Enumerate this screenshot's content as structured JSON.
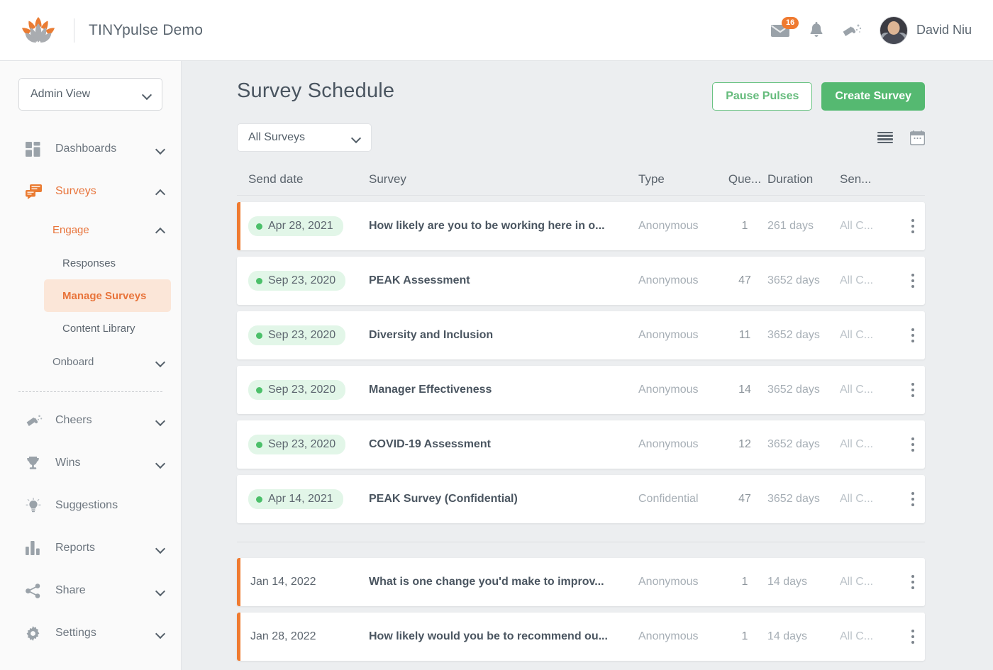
{
  "header": {
    "brand_title": "TINYpulse Demo",
    "logo_icon": "lotus-logo-icon",
    "mail_icon": "envelope-icon",
    "mail_badge": "16",
    "bell_icon": "bell-icon",
    "cheers_icon": "megaphone-icon",
    "avatar_icon": "user-avatar",
    "username": "David Niu"
  },
  "sidebar": {
    "view_selector": {
      "label": "Admin View",
      "chevron": "chevron-down-icon"
    },
    "items": [
      {
        "label": "Dashboards",
        "icon": "grid-dashboard-icon",
        "chevron": "chevron-down-icon",
        "state": "collapsed"
      },
      {
        "label": "Surveys",
        "icon": "survey-chat-icon",
        "chevron": "chevron-up-icon",
        "state": "expanded"
      }
    ],
    "surveys_children": {
      "engage": {
        "label": "Engage",
        "chevron": "chevron-up-icon"
      },
      "engage_children": [
        {
          "label": "Responses"
        },
        {
          "label": "Manage Surveys",
          "selected": true
        },
        {
          "label": "Content Library"
        }
      ],
      "onboard": {
        "label": "Onboard",
        "chevron": "chevron-down-icon"
      }
    },
    "bottom_items": [
      {
        "label": "Cheers",
        "icon": "megaphone-icon",
        "chevron": "chevron-down-icon"
      },
      {
        "label": "Wins",
        "icon": "trophy-icon",
        "chevron": "chevron-down-icon"
      },
      {
        "label": "Suggestions",
        "icon": "lightbulb-icon",
        "chevron": ""
      },
      {
        "label": "Reports",
        "icon": "bar-chart-icon",
        "chevron": "chevron-down-icon"
      },
      {
        "label": "Share",
        "icon": "share-nodes-icon",
        "chevron": "chevron-down-icon"
      },
      {
        "label": "Settings",
        "icon": "gear-icon",
        "chevron": "chevron-down-icon"
      }
    ]
  },
  "main": {
    "page_title": "Survey Schedule",
    "pause_button": "Pause Pulses",
    "create_button": "Create Survey",
    "survey_filter": {
      "value": "All Surveys",
      "chevron": "chevron-down-icon"
    },
    "view_toggles": [
      {
        "icon": "list-view-icon",
        "active": true
      },
      {
        "icon": "calendar-view-icon",
        "active": false
      }
    ],
    "table": {
      "columns": [
        "Send date",
        "Survey",
        "Type",
        "Que...",
        "Duration",
        "Sen..."
      ],
      "group1": [
        {
          "date": "Apr 28, 2021",
          "status_dot": true,
          "survey": "How likely are you to be working here in o...",
          "type": "Anonymous",
          "questions": "1",
          "duration": "261 days",
          "sent_to": "All C...",
          "flagged": true
        },
        {
          "date": "Sep 23, 2020",
          "status_dot": true,
          "survey": "PEAK Assessment",
          "type": "Anonymous",
          "questions": "47",
          "duration": "3652 days",
          "sent_to": "All C...",
          "flagged": false
        },
        {
          "date": "Sep 23, 2020",
          "status_dot": true,
          "survey": "Diversity and Inclusion",
          "type": "Anonymous",
          "questions": "11",
          "duration": "3652 days",
          "sent_to": "All C...",
          "flagged": false
        },
        {
          "date": "Sep 23, 2020",
          "status_dot": true,
          "survey": "Manager Effectiveness",
          "type": "Anonymous",
          "questions": "14",
          "duration": "3652 days",
          "sent_to": "All C...",
          "flagged": false
        },
        {
          "date": "Sep 23, 2020",
          "status_dot": true,
          "survey": "COVID-19 Assessment",
          "type": "Anonymous",
          "questions": "12",
          "duration": "3652 days",
          "sent_to": "All C...",
          "flagged": false
        },
        {
          "date": "Apr 14, 2021",
          "status_dot": true,
          "survey": "PEAK Survey (Confidential)",
          "type": "Confidential",
          "questions": "47",
          "duration": "3652 days",
          "sent_to": "All C...",
          "flagged": false
        }
      ],
      "group2": [
        {
          "date": "Jan 14, 2022",
          "status_dot": false,
          "survey": "What is one change you'd make to improv...",
          "type": "Anonymous",
          "questions": "1",
          "duration": "14 days",
          "sent_to": "All C...",
          "flagged": true
        },
        {
          "date": "Jan 28, 2022",
          "status_dot": false,
          "survey": "How likely would you be to recommend ou...",
          "type": "Anonymous",
          "questions": "1",
          "duration": "14 days",
          "sent_to": "All C...",
          "flagged": true
        }
      ]
    }
  },
  "colors": {
    "brand_orange": "#ef7a30",
    "accent_orange": "#e8743b",
    "green_primary": "#55b971",
    "green_outline": "#64bb7b",
    "status_green": "#4cc06a",
    "pill_green_bg": "#e2f6e8",
    "selected_bg": "#fbe6d8",
    "page_bg": "#eceef0"
  }
}
